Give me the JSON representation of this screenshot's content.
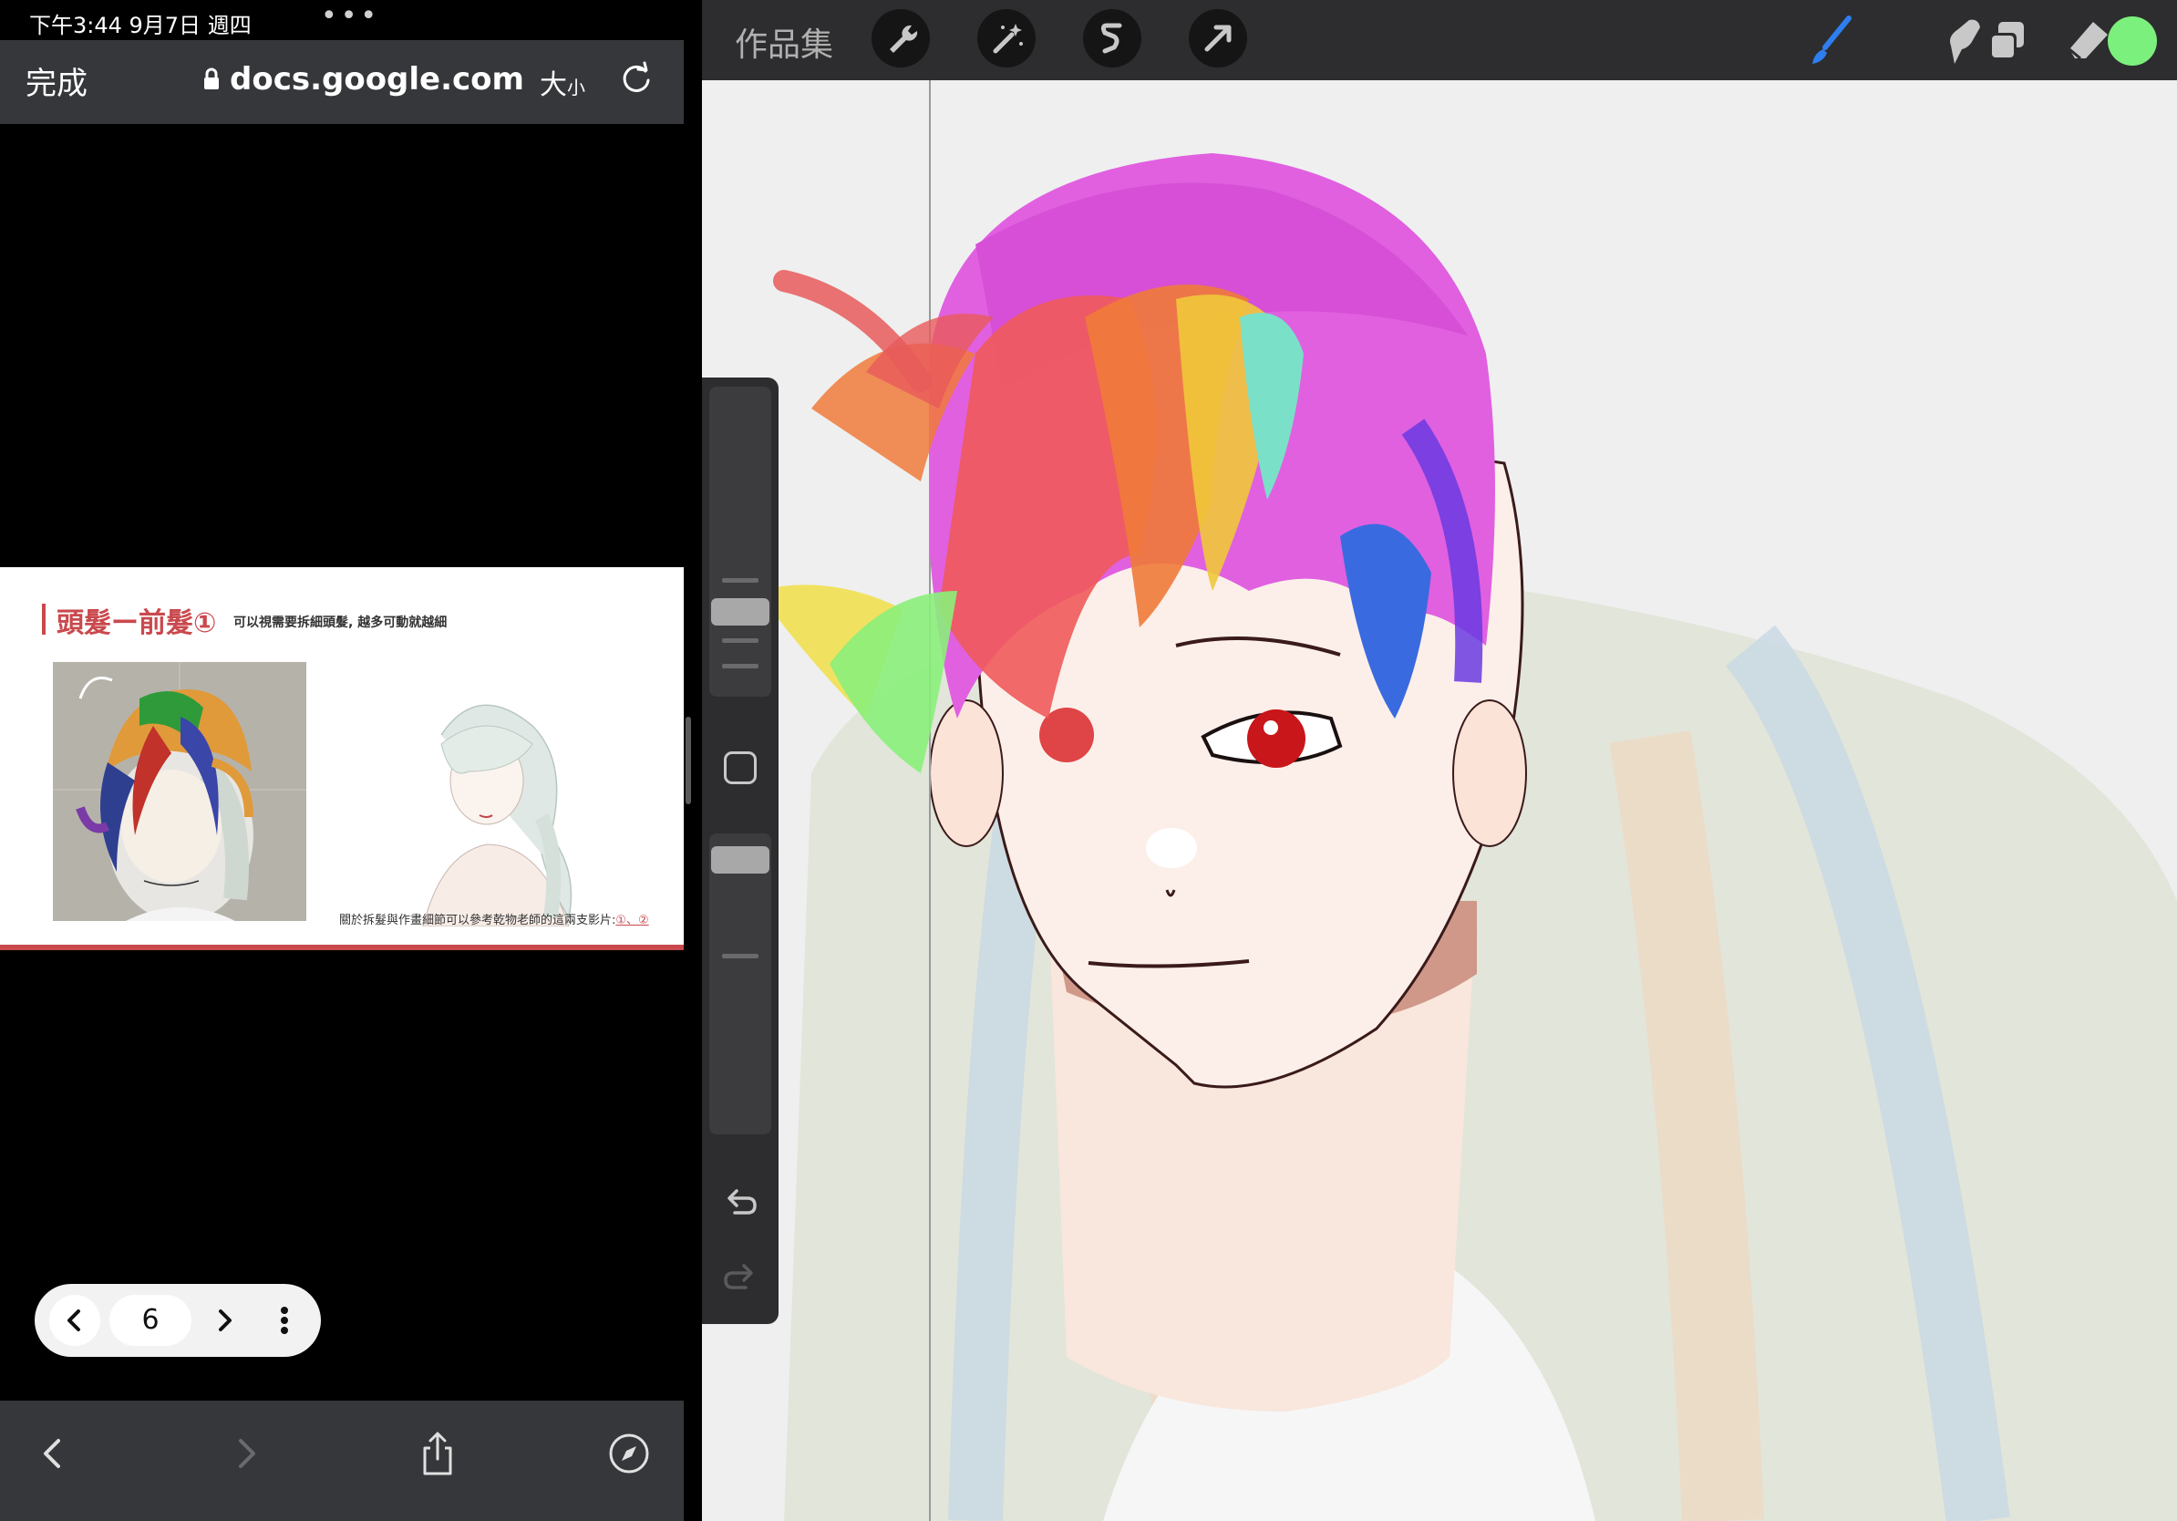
{
  "status_bar": {
    "time": "下午3:44 9月7日 週四",
    "multitask_dots": "•••"
  },
  "safari": {
    "done_label": "完成",
    "url": "docs.google.com",
    "text_size_big": "大",
    "text_size_small": "小",
    "reload_icon": "reload-icon"
  },
  "slide": {
    "title": "頭髮ー前髮①",
    "subtitle": "可以視需要拆細頭髮, 越多可動就越細",
    "note": "關於拆髮與作畫細節可以參考乾物老師的這兩支影片:",
    "note_links": "①、②",
    "accent_color": "#c9494d"
  },
  "page_nav": {
    "page_number": "6"
  },
  "procreate": {
    "gallery_label": "作品集",
    "left_tools": [
      "wrench-icon",
      "magic-wand-icon",
      "selection-icon",
      "transform-arrow-icon"
    ],
    "right_tools": [
      "brush-icon",
      "smudge-icon",
      "eraser-icon",
      "layers-icon"
    ],
    "brush_color": "#7cf07c"
  }
}
